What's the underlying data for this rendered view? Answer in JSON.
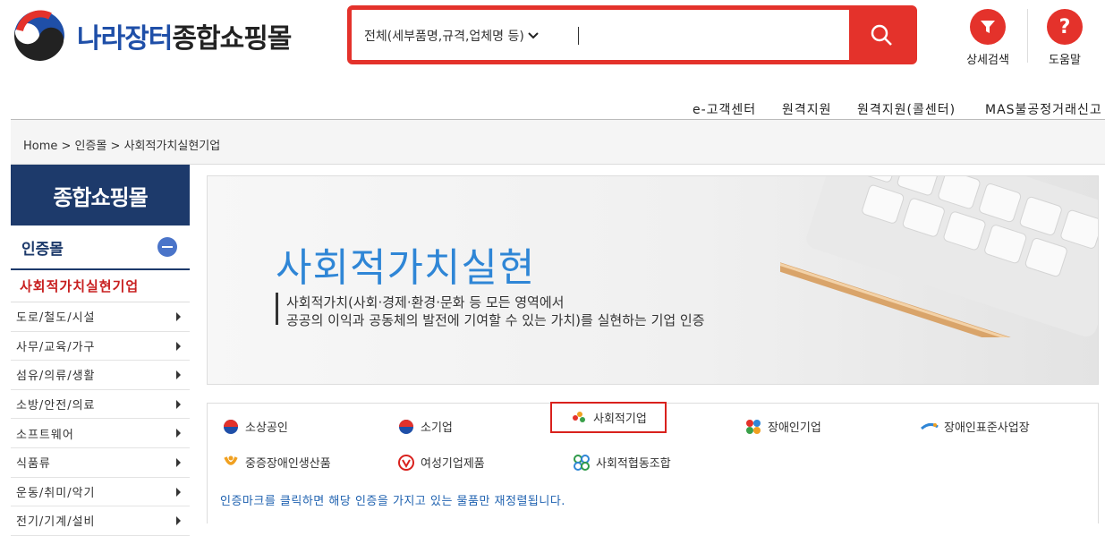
{
  "header": {
    "logo_text_a": "나라장터",
    "logo_text_b": "종합쇼핑몰",
    "search_scope": "전체(세부품명,규격,업체명 등)",
    "search_value": "",
    "detail_search": "상세검색",
    "help": "도움말"
  },
  "topnav": [
    "e-고객센터",
    "원격지원",
    "원격지원(콜센터)",
    "MAS불공정거래신고"
  ],
  "breadcrumb": "Home > 인증몰 > 사회적가치실현기업",
  "sidebar": {
    "title": "종합쇼핑몰",
    "category": "인증몰",
    "selected": "사회적가치실현기업",
    "items": [
      "도로/철도/시설",
      "사무/교육/가구",
      "섬유/의류/생활",
      "소방/안전/의료",
      "소프트웨어",
      "식품류",
      "운동/취미/악기",
      "전기/기계/설비"
    ]
  },
  "banner": {
    "title": "사회적가치실현",
    "line1": "사회적가치(사회·경제·환경·문화 등 모든 영역에서",
    "line2": "공공의 이익과 공동체의 발전에 기여할 수 있는 가치)를 실현하는 기업 인증"
  },
  "certs": [
    "소상공인",
    "소기업",
    "사회적기업",
    "장애인기업",
    "장애인표준사업장",
    "중증장애인생산품",
    "여성기업제품",
    "사회적협동조합"
  ],
  "notice": "인증마크를 클릭하면 해당 인증을 가지고 있는 물품만 재정렬됩니다.",
  "colors": {
    "brand_red": "#e4322b",
    "navy": "#1d3a6b",
    "accent_blue": "#2f86d6"
  }
}
